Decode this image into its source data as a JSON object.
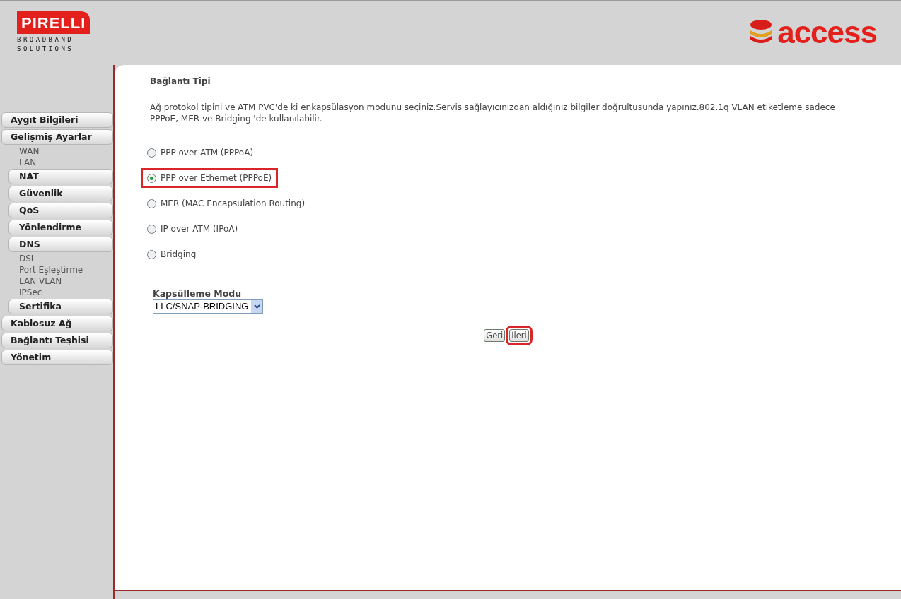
{
  "header": {
    "brand_left": {
      "name": "PIRELLI",
      "tagline": [
        "BROADBAND",
        "SOLUTIONS"
      ]
    },
    "brand_right": {
      "name": "access"
    }
  },
  "sidebar": {
    "items": [
      {
        "label": "Aygıt Bilgileri",
        "kind": "main"
      },
      {
        "label": "Gelişmiş Ayarlar",
        "kind": "main",
        "children": [
          {
            "label": "WAN",
            "kind": "link"
          },
          {
            "label": "LAN",
            "kind": "link"
          },
          {
            "label": "NAT",
            "kind": "sub"
          },
          {
            "label": "Güvenlik",
            "kind": "sub"
          },
          {
            "label": "QoS",
            "kind": "sub"
          },
          {
            "label": "Yönlendirme",
            "kind": "sub"
          },
          {
            "label": "DNS",
            "kind": "sub"
          },
          {
            "label": "DSL",
            "kind": "link"
          },
          {
            "label": "Port Eşleştirme",
            "kind": "link"
          },
          {
            "label": "LAN VLAN",
            "kind": "link"
          },
          {
            "label": "IPSec",
            "kind": "link"
          },
          {
            "label": "Sertifika",
            "kind": "sub"
          }
        ]
      },
      {
        "label": "Kablosuz Ağ",
        "kind": "main"
      },
      {
        "label": "Bağlantı Teşhisi",
        "kind": "main"
      },
      {
        "label": "Yönetim",
        "kind": "main"
      }
    ]
  },
  "content": {
    "title": "Bağlantı Tipi",
    "description": "Ağ protokol tipini ve ATM PVC'de ki enkapsülasyon modunu seçiniz.Servis sağlayıcınızdan aldığınız bilgiler doğrultusunda yapınız.802.1q VLAN etiketleme sadece PPPoE, MER ve Bridging 'de kullanılabilir.",
    "options": [
      {
        "label": "PPP over ATM (PPPoA)",
        "selected": false,
        "highlighted": false
      },
      {
        "label": "PPP over Ethernet (PPPoE)",
        "selected": true,
        "highlighted": true
      },
      {
        "label": "MER (MAC Encapsulation Routing)",
        "selected": false,
        "highlighted": false
      },
      {
        "label": "IP over ATM (IPoA)",
        "selected": false,
        "highlighted": false
      },
      {
        "label": "Bridging",
        "selected": false,
        "highlighted": false
      }
    ],
    "encapsulation": {
      "label": "Kapsülleme Modu",
      "value": "LLC/SNAP-BRIDGING"
    },
    "buttons": [
      {
        "label": "Geri",
        "highlighted": false
      },
      {
        "label": "İleri",
        "highlighted": true
      }
    ]
  }
}
